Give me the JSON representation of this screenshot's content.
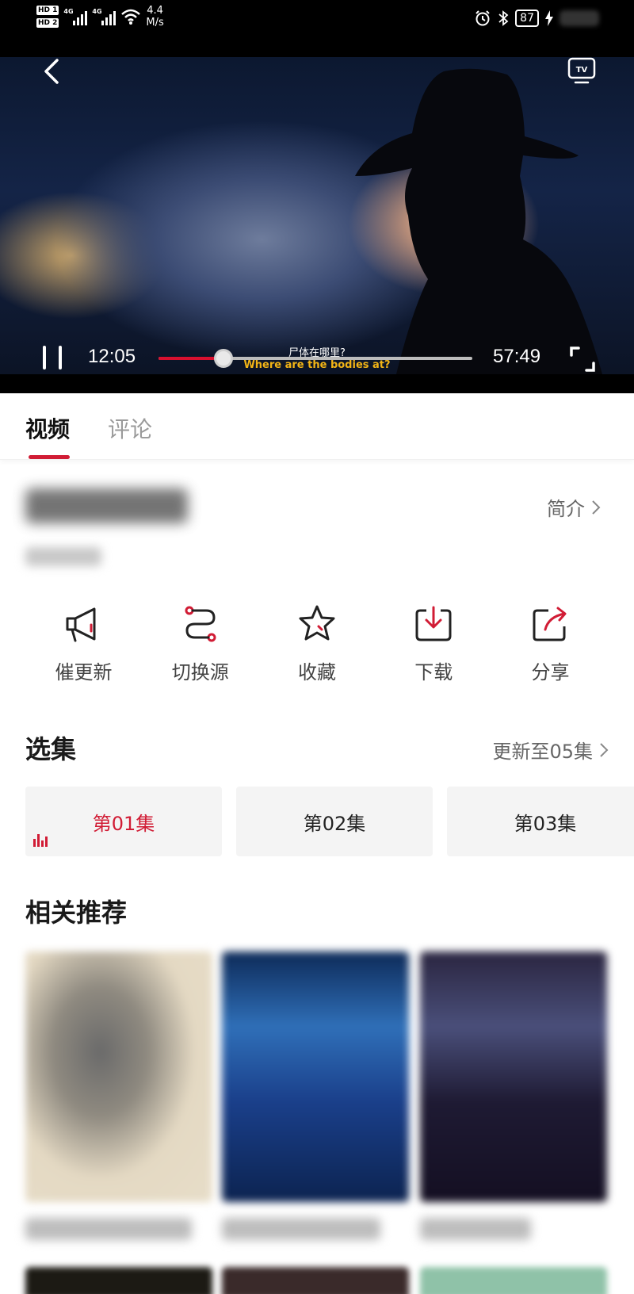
{
  "status_bar": {
    "network_speed_value": "4.4",
    "network_speed_unit": "M/s",
    "battery": "87",
    "sim1": "HD 1",
    "sim2": "HD 2",
    "net_type": "4G"
  },
  "player": {
    "current_time": "12:05",
    "total_time": "57:49",
    "progress_fraction": 0.208,
    "subtitle_zh": "尸体在哪里?",
    "subtitle_en": "Where are the bodies at?"
  },
  "tabs": [
    {
      "label": "视频"
    },
    {
      "label": "评论"
    }
  ],
  "intro_link": "简介",
  "actions": [
    {
      "label": "催更新",
      "icon": "megaphone-icon"
    },
    {
      "label": "切换源",
      "icon": "switch-source-icon"
    },
    {
      "label": "收藏",
      "icon": "star-icon"
    },
    {
      "label": "下载",
      "icon": "download-icon"
    },
    {
      "label": "分享",
      "icon": "share-icon"
    }
  ],
  "episodes": {
    "title": "选集",
    "more": "更新至05集",
    "items": [
      {
        "label": "第01集",
        "active": true
      },
      {
        "label": "第02集",
        "active": false
      },
      {
        "label": "第03集",
        "active": false
      }
    ]
  },
  "recommend": {
    "title": "相关推荐"
  },
  "colors": {
    "accent": "#d11c35"
  }
}
